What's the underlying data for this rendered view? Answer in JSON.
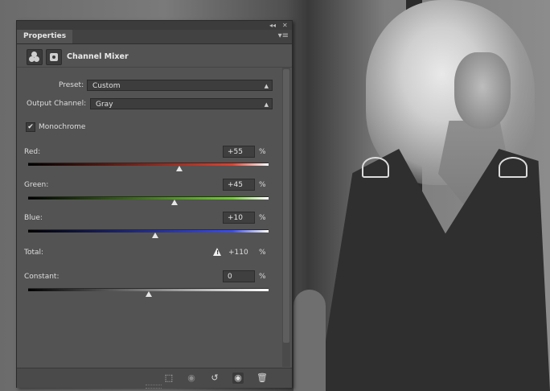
{
  "panel": {
    "tab_label": "Properties",
    "title": "Channel Mixer",
    "collapse_glyph": "◂◂",
    "close_glyph": "✕",
    "menu_glyph": "▾≡"
  },
  "preset": {
    "label": "Preset:",
    "value": "Custom"
  },
  "output_channel": {
    "label": "Output Channel:",
    "value": "Gray"
  },
  "monochrome": {
    "label": "Monochrome",
    "checked": true,
    "mark": "✔"
  },
  "channels": [
    {
      "label": "Red:",
      "value": "+55",
      "unit": "%",
      "slider_fraction": 0.63,
      "color": "#e0412f"
    },
    {
      "label": "Green:",
      "value": "+45",
      "unit": "%",
      "slider_fraction": 0.61,
      "color": "#6fd02c"
    },
    {
      "label": "Blue:",
      "value": "+10",
      "unit": "%",
      "slider_fraction": 0.53,
      "color": "#3a4cf0"
    }
  ],
  "total": {
    "label": "Total:",
    "value": "+110",
    "unit": "%",
    "warning_glyph": "!"
  },
  "constant": {
    "label": "Constant:",
    "value": "0",
    "unit": "%",
    "slider_fraction": 0.5
  },
  "footer_icons": [
    "clip-to-layer-icon",
    "view-previous-state-icon",
    "reset-icon",
    "visibility-eye-icon",
    "trash-icon"
  ]
}
